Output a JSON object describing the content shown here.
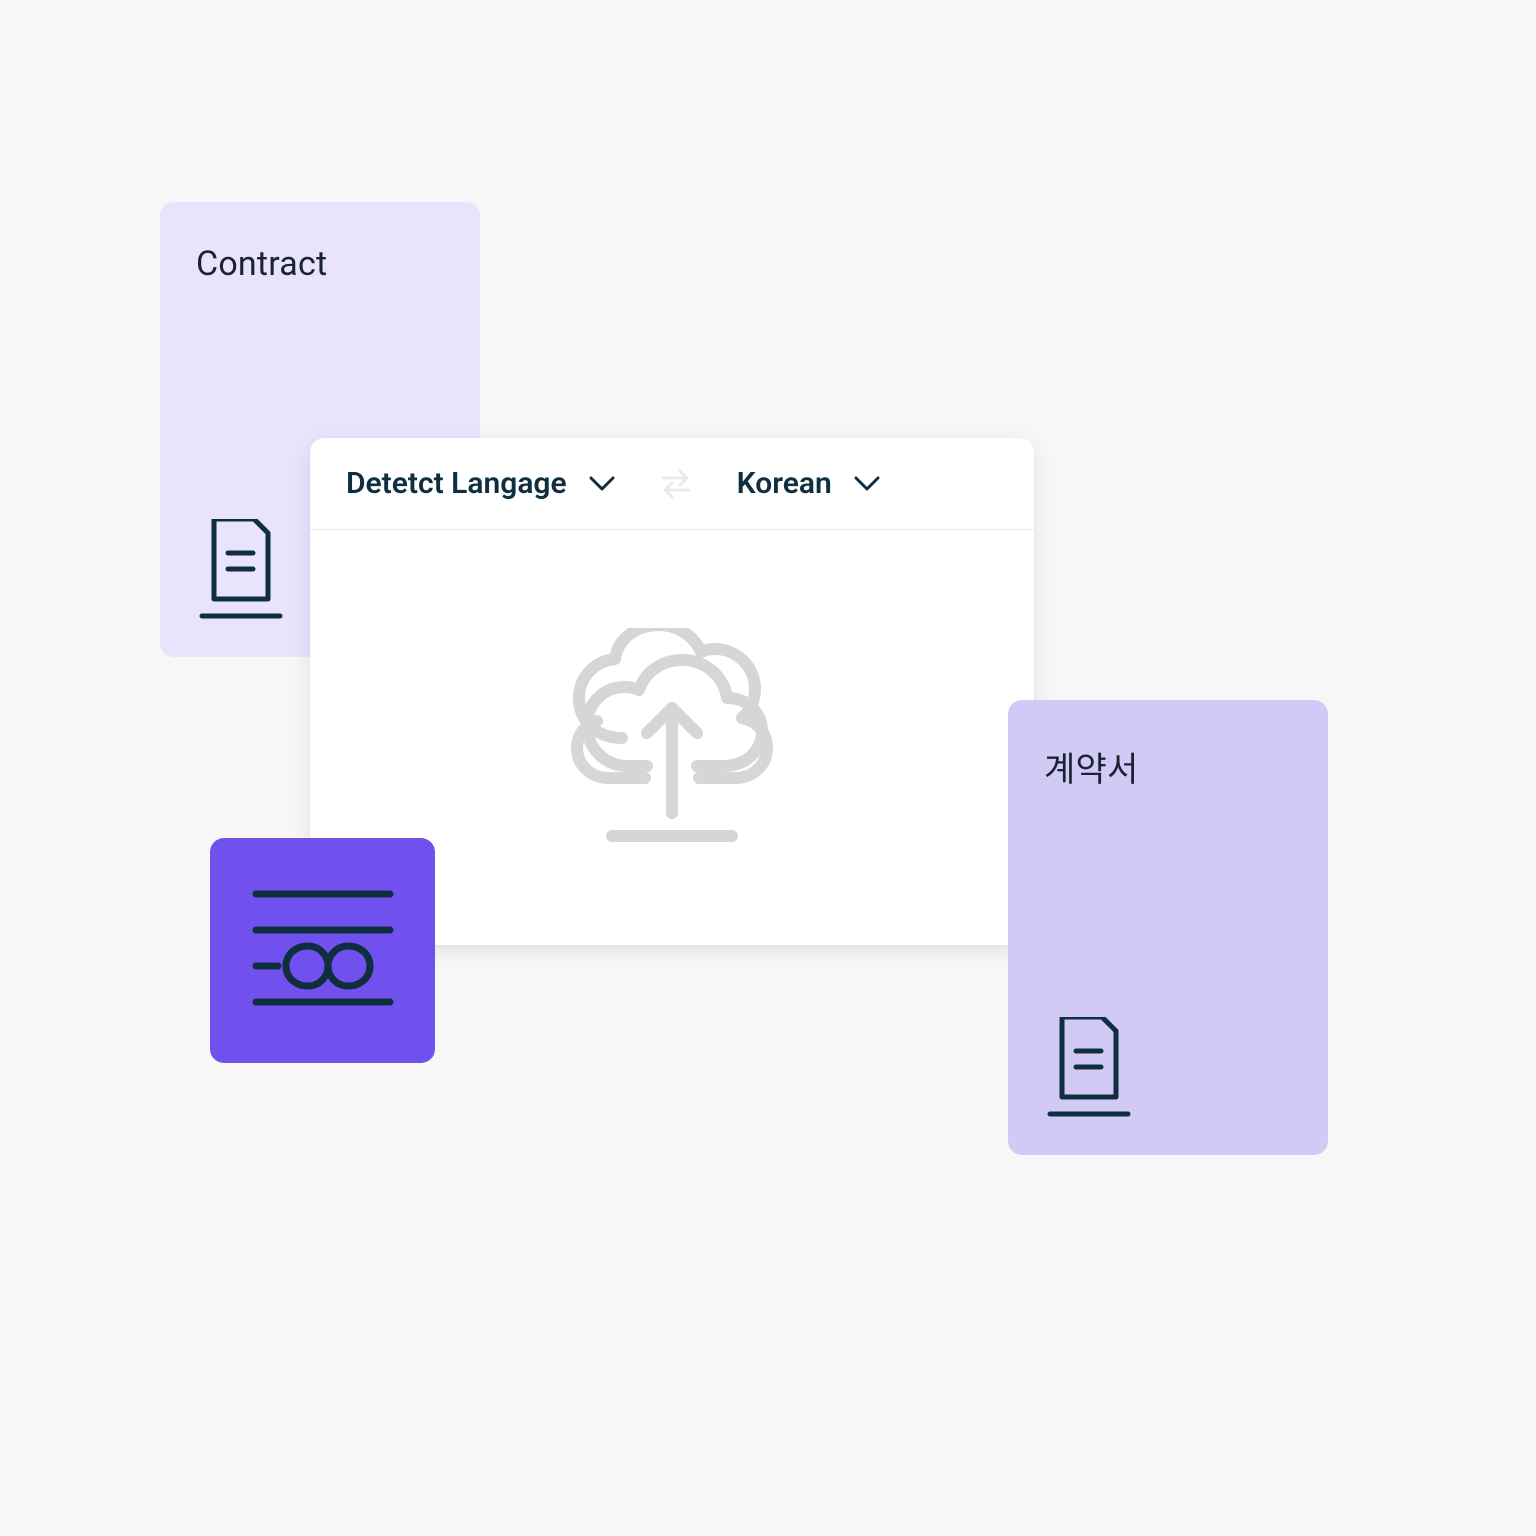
{
  "source_doc": {
    "title": "Contract"
  },
  "target_doc": {
    "title": "계약서"
  },
  "translator": {
    "source_lang": "Detetct Langage",
    "target_lang": "Korean"
  },
  "colors": {
    "dark": "#0f2e3f",
    "border_light": "#e9ecef",
    "icon_grey": "#d5d6d7",
    "purple_accent": "#7151ed",
    "lavender_light": "#e9e3fb",
    "lavender_mid": "#d2c9f6"
  }
}
